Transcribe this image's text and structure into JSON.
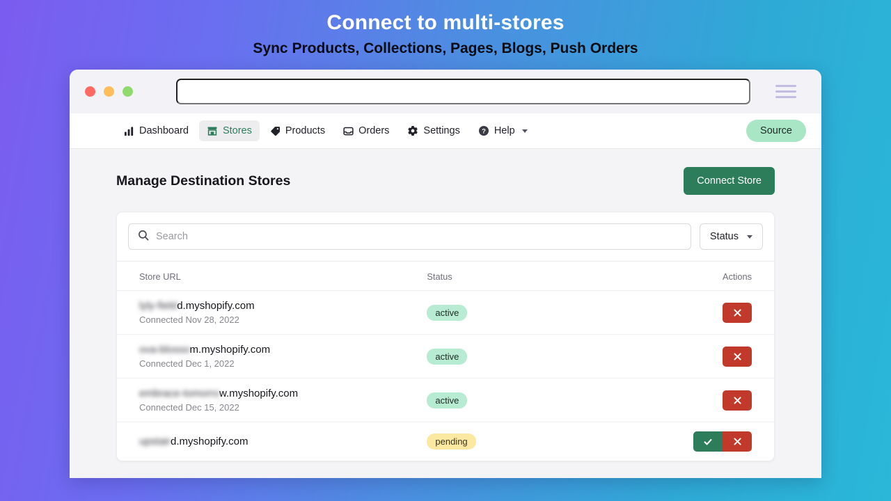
{
  "promo": {
    "title": "Connect to multi-stores",
    "subtitle": "Sync Products, Collections, Pages, Blogs, Push Orders"
  },
  "browser": {
    "address_value": "",
    "address_placeholder": "",
    "menu_icon": "hamburger-icon",
    "traffic_lights": [
      "close-dot",
      "minimize-dot",
      "maximize-dot"
    ]
  },
  "nav": {
    "items": [
      {
        "label": "Dashboard",
        "icon": "bar-chart-icon",
        "active": false,
        "dropdown": false
      },
      {
        "label": "Stores",
        "icon": "store-icon",
        "active": true,
        "dropdown": false
      },
      {
        "label": "Products",
        "icon": "tag-icon",
        "active": false,
        "dropdown": false
      },
      {
        "label": "Orders",
        "icon": "inbox-icon",
        "active": false,
        "dropdown": false
      },
      {
        "label": "Settings",
        "icon": "gear-icon",
        "active": false,
        "dropdown": false
      },
      {
        "label": "Help",
        "icon": "question-circle-icon",
        "active": false,
        "dropdown": true
      }
    ],
    "source_badge": "Source"
  },
  "page": {
    "title": "Manage Destination Stores",
    "connect_button": "Connect Store"
  },
  "toolbar": {
    "search_placeholder": "Search",
    "search_value": "",
    "search_icon": "search-icon",
    "status_filter_label": "Status",
    "status_filter_icon": "chevron-down-icon"
  },
  "table": {
    "columns": [
      "Store URL",
      "Status",
      "Actions"
    ],
    "rows": [
      {
        "url_hidden": "lyly-field",
        "url_visible": "d.myshopify.com",
        "connected": "Connected Nov 28, 2022",
        "status": "active",
        "status_type": "active",
        "actions": [
          "delete"
        ]
      },
      {
        "url_hidden": "ova-blosso",
        "url_visible": "m.myshopify.com",
        "connected": "Connected Dec 1, 2022",
        "status": "active",
        "status_type": "active",
        "actions": [
          "delete"
        ]
      },
      {
        "url_hidden": "embrace-tomorro",
        "url_visible": "w.myshopify.com",
        "connected": "Connected Dec 15, 2022",
        "status": "active",
        "status_type": "active",
        "actions": [
          "delete"
        ]
      },
      {
        "url_hidden": "upstair",
        "url_visible": "d.myshopify.com",
        "connected": "",
        "status": "pending",
        "status_type": "pending",
        "actions": [
          "approve",
          "delete"
        ]
      }
    ]
  },
  "colors": {
    "brand_green": "#2e7d5a",
    "danger_red": "#c0392b",
    "badge_active": "#b8ecd2",
    "badge_pending": "#fbe9a1",
    "source_pill": "#a8e6c6",
    "gradient_start": "#7b5cf0",
    "gradient_end": "#29b8d8"
  }
}
